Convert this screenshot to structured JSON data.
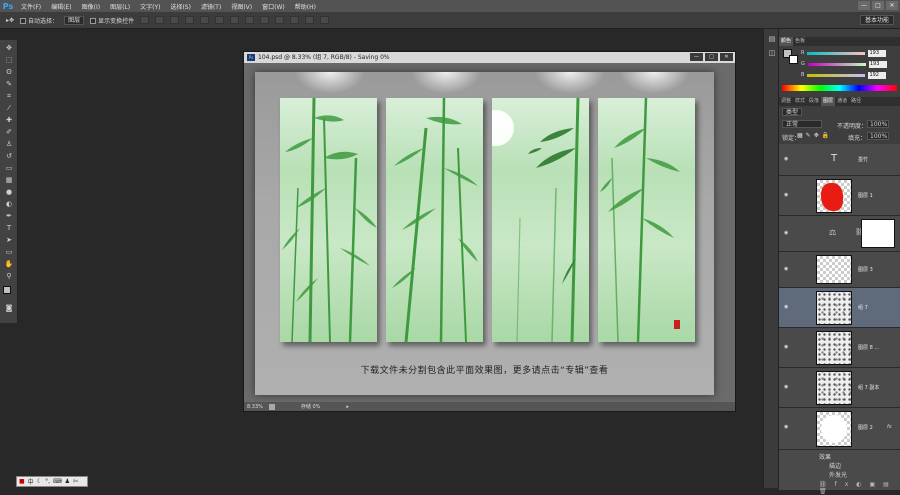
{
  "app": {
    "logo": "Ps"
  },
  "menu": [
    "文件(F)",
    "编辑(E)",
    "图像(I)",
    "图层(L)",
    "文字(Y)",
    "选择(S)",
    "滤镜(T)",
    "视图(V)",
    "窗口(W)",
    "帮助(H)"
  ],
  "window_controls": {
    "minimize": "—",
    "maximize": "□",
    "close": "✕"
  },
  "options_bar": {
    "auto_select_label": "自动选择：",
    "auto_select_value": "图层",
    "show_transform_label": "显示变换控件",
    "workspace": "基本功能"
  },
  "document": {
    "title": "104.psd @ 8.33% (组 7, RGB/8) - Saving 0%",
    "caption": "下载文件未分割包含此平面效果图，更多请点击“专辑”查看",
    "zoom": "8.33%",
    "status": "存储 0%",
    "colors": {
      "bamboo": "#3f9a3f",
      "bamboo_dark": "#2d7a2d",
      "seal": "#c8201c"
    }
  },
  "color_panel": {
    "tabs": [
      "颜色",
      "色板"
    ],
    "r": "193",
    "g": "193",
    "b": "192",
    "r_label": "R",
    "g_label": "G",
    "b_label": "B"
  },
  "adjust_tabs": [
    "调整",
    "样式"
  ],
  "layers_panel": {
    "tabs": [
      "调整",
      "样式",
      "段落",
      "图层",
      "通道",
      "路径"
    ],
    "kind_label": "类型",
    "blend_mode": "正常",
    "opacity_label": "不透明度：",
    "opacity": "100%",
    "lock_label": "锁定：",
    "fill_label": "填充：",
    "fill": "100%",
    "layers": [
      {
        "name": "墨竹",
        "type": "text"
      },
      {
        "name": "图层 1",
        "type": "red"
      },
      {
        "name": "",
        "type": "adjust"
      },
      {
        "name": "图层 3",
        "type": "checker"
      },
      {
        "name": "组 7",
        "type": "texture"
      },
      {
        "name": "图层 8 ...",
        "type": "texture"
      },
      {
        "name": "组 7 副本",
        "type": "texture"
      },
      {
        "name": "图层 2",
        "type": "white"
      }
    ],
    "fx_label": "fx",
    "effects_label": "效果",
    "effect_1": "描边",
    "effect_2": "外发光"
  },
  "taskbar": {
    "lang": "中"
  }
}
